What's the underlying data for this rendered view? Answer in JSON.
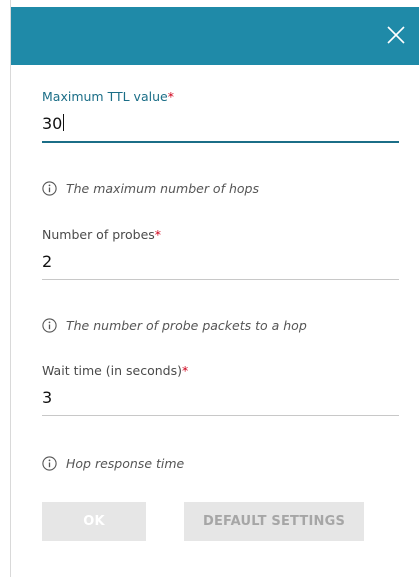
{
  "header": {
    "close_icon": "close-icon",
    "background": "#1f8aa8"
  },
  "fields": [
    {
      "label": "Maximum TTL value",
      "required_mark": "*",
      "value": "30",
      "hint": "The maximum number of hops",
      "focused": true
    },
    {
      "label": "Number of probes",
      "required_mark": "*",
      "value": "2",
      "hint": "The number of probe packets to a hop",
      "focused": false
    },
    {
      "label": "Wait time (in seconds)",
      "required_mark": "*",
      "value": "3",
      "hint": "Hop response time",
      "focused": false
    }
  ],
  "hint_icon": "info-icon",
  "buttons": {
    "ok_label": "OK",
    "default_label": "DEFAULT SETTINGS"
  },
  "colors": {
    "accent": "#1b6e87",
    "required": "#d0021b",
    "button_disabled_bg": "#e6e6e6"
  }
}
